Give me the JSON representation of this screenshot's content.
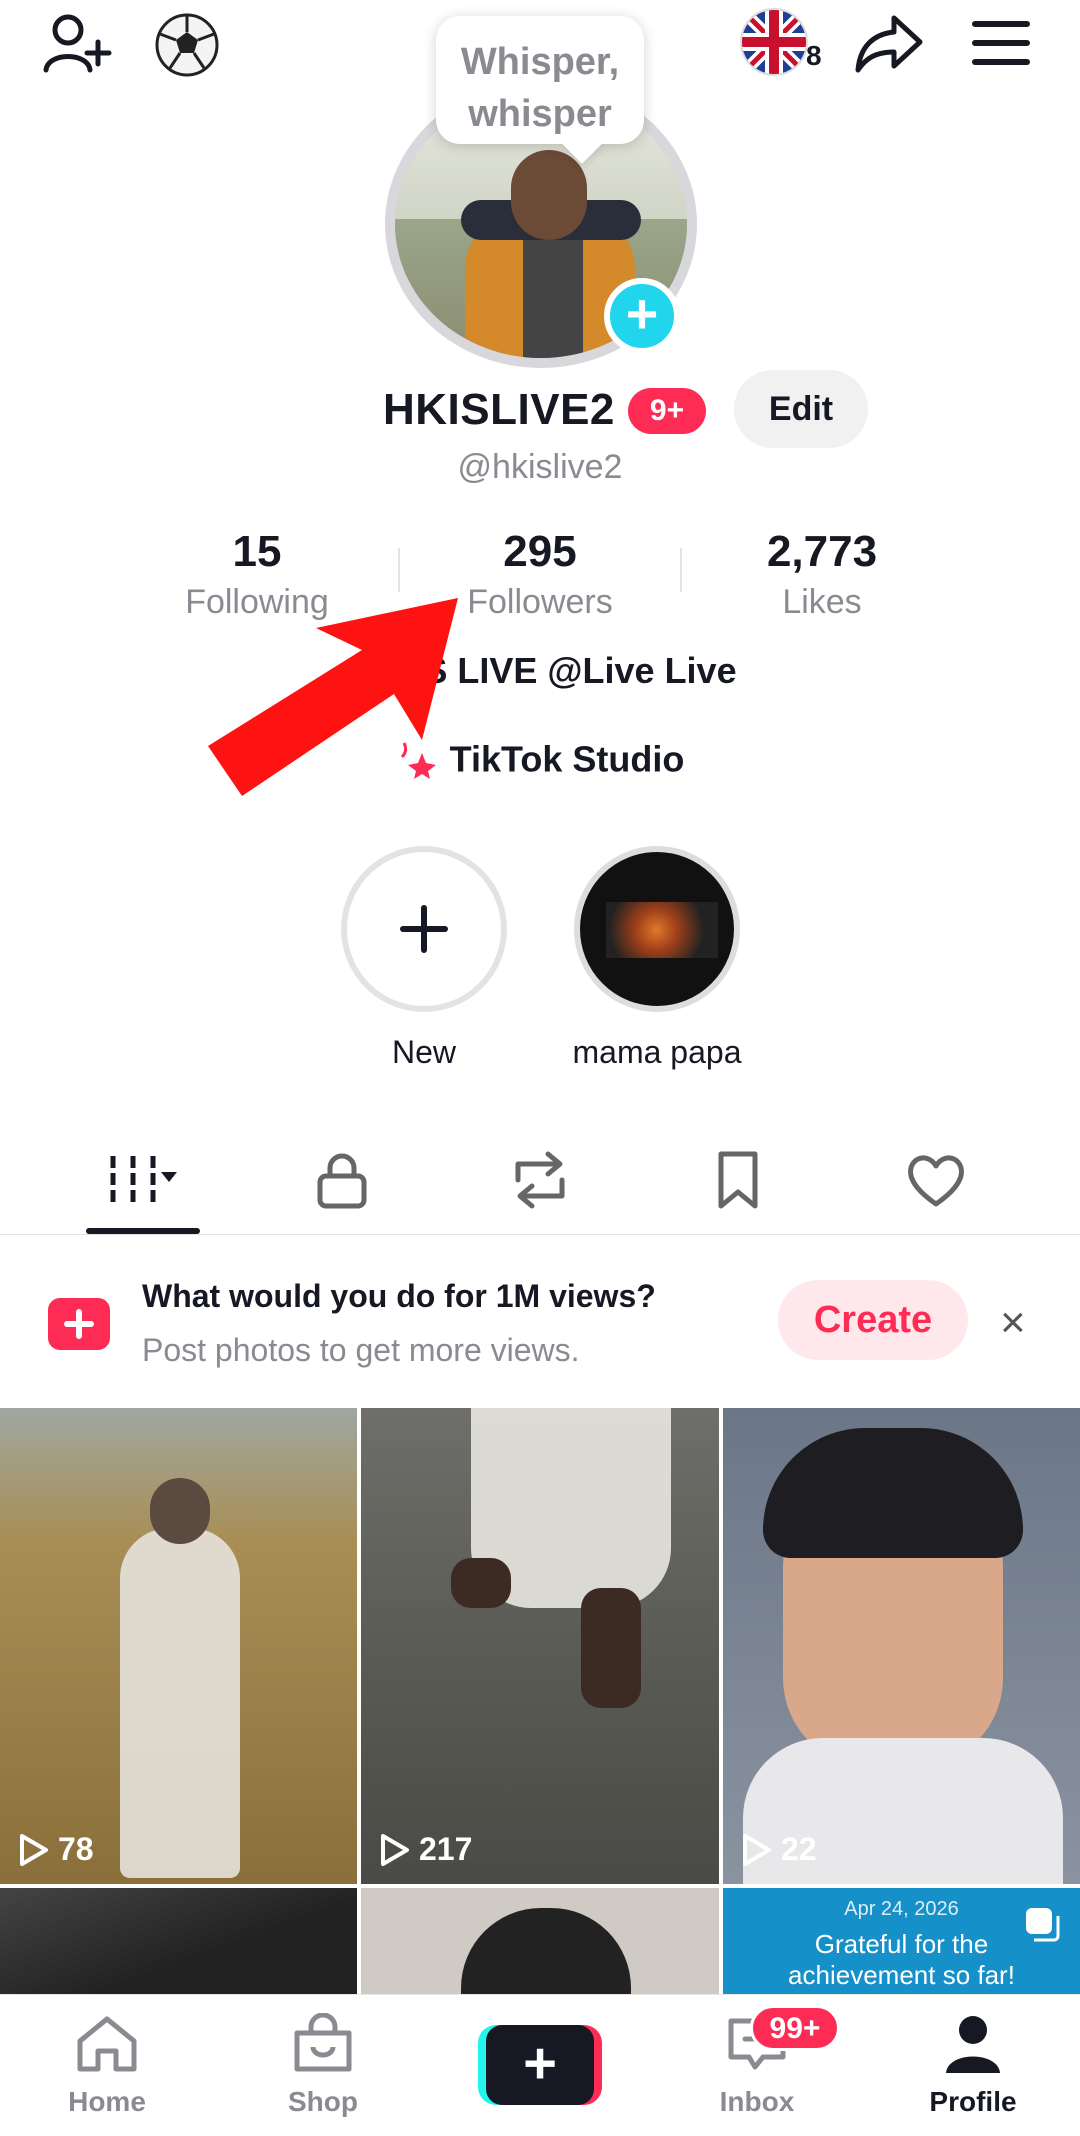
{
  "top_bar": {
    "flag_count": "8"
  },
  "tooltip": {
    "line1": "Whisper,",
    "line2": "whisper"
  },
  "profile": {
    "display_name": "HKISLIVE2",
    "name_badge": "9+",
    "edit_label": "Edit",
    "handle": "@hkislive2"
  },
  "stats": [
    {
      "value": "15",
      "label": "Following"
    },
    {
      "value": "295",
      "label": "Followers"
    },
    {
      "value": "2,773",
      "label": "Likes"
    }
  ],
  "bio": {
    "line1": "S LIVE @Live Live",
    "studio_label": "TikTok Studio"
  },
  "highlights": [
    {
      "label": "New"
    },
    {
      "label": "mama papa"
    }
  ],
  "promo": {
    "title": "What would you do for 1M views?",
    "subtitle": "Post photos to get more views.",
    "create_label": "Create",
    "close_glyph": "×"
  },
  "videos": [
    {
      "views": "78"
    },
    {
      "views": "217"
    },
    {
      "views": "22"
    }
  ],
  "third_row": {
    "date": "Apr 24, 2026",
    "caption_line1": "Grateful for the",
    "caption_line2": "achievement so far!"
  },
  "nav": {
    "home": "Home",
    "shop": "Shop",
    "plus": "+",
    "inbox": "Inbox",
    "inbox_badge": "99+",
    "profile": "Profile"
  },
  "colors": {
    "accent_red": "#fe2c55",
    "accent_cyan": "#25f4ee",
    "text_primary": "#161823",
    "text_secondary": "#8a8b91"
  },
  "icons": [
    "add-user-icon",
    "soccer-ball-icon",
    "uk-flag-icon",
    "share-icon",
    "menu-icon",
    "grid-videos-icon",
    "lock-icon",
    "repost-icon",
    "bookmark-icon",
    "heart-icon",
    "home-icon",
    "shop-bag-icon",
    "inbox-icon",
    "profile-icon"
  ]
}
